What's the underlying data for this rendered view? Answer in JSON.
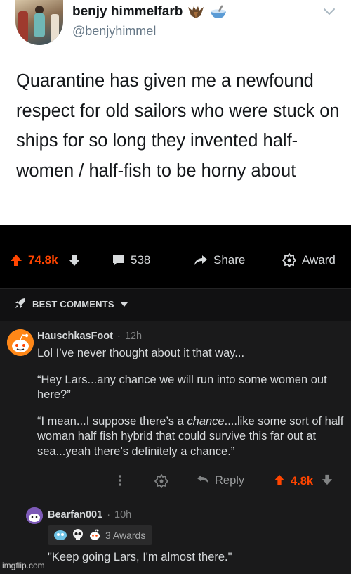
{
  "tweet": {
    "display_name": "benjy himmelfarb",
    "handle": "@benjyhimmel",
    "text": "Quarantine has given me a newfound respect for old sailors who were stuck on ships for so long they invented half-women / half-fish to be horny about",
    "name_emojis": [
      "bat-emoji",
      "bowl-emoji"
    ]
  },
  "post_actions": {
    "score": "74.8k",
    "comments": "538",
    "share_label": "Share",
    "award_label": "Award"
  },
  "sort": {
    "label": "BEST COMMENTS"
  },
  "comments": [
    {
      "author": "HauschkasFoot",
      "separator": "·",
      "time": "12h",
      "paragraphs": [
        "Lol I’ve never thought about it that way...",
        "“Hey Lars...any chance we will run into some women out here?”",
        "“I mean...I suppose there’s a ",
        "chance",
        "....like some sort of half woman half fish hybrid that could survive this far out at sea...yeah there’s definitely a chance.”"
      ],
      "reply_label": "Reply",
      "score": "4.8k"
    },
    {
      "author": "Bearfan001",
      "separator": "·",
      "time": "10h",
      "awards_label": "3 Awards",
      "body": "\"Keep going Lars, I'm almost there.\""
    }
  ],
  "watermark": "imgflip.com",
  "colors": {
    "upvote": "#ff4500",
    "dark_bg": "#1a1a1b",
    "text_light": "#d7dadc",
    "muted": "#818384"
  }
}
